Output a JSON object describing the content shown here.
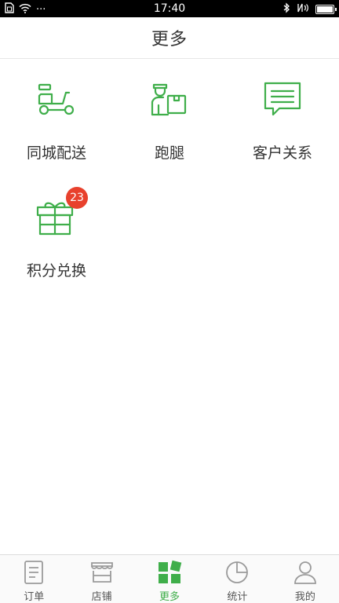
{
  "status_bar": {
    "time": "17:40",
    "more_symbol": "···"
  },
  "header": {
    "title": "更多"
  },
  "grid": {
    "items": [
      {
        "label": "同城配送",
        "icon": "scooter-icon"
      },
      {
        "label": "跑腿",
        "icon": "courier-icon"
      },
      {
        "label": "客户关系",
        "icon": "message-icon"
      },
      {
        "label": "积分兑换",
        "icon": "gift-icon",
        "badge": "23"
      }
    ]
  },
  "bottom_nav": {
    "items": [
      {
        "label": "订单",
        "icon": "order-icon",
        "active": false
      },
      {
        "label": "店铺",
        "icon": "shop-icon",
        "active": false
      },
      {
        "label": "更多",
        "icon": "more-grid-icon",
        "active": true
      },
      {
        "label": "统计",
        "icon": "pie-chart-icon",
        "active": false
      },
      {
        "label": "我的",
        "icon": "user-icon",
        "active": false
      }
    ]
  },
  "colors": {
    "accent": "#3fae4a",
    "badge": "#e8412d",
    "nav_inactive": "#9a9a9a"
  }
}
